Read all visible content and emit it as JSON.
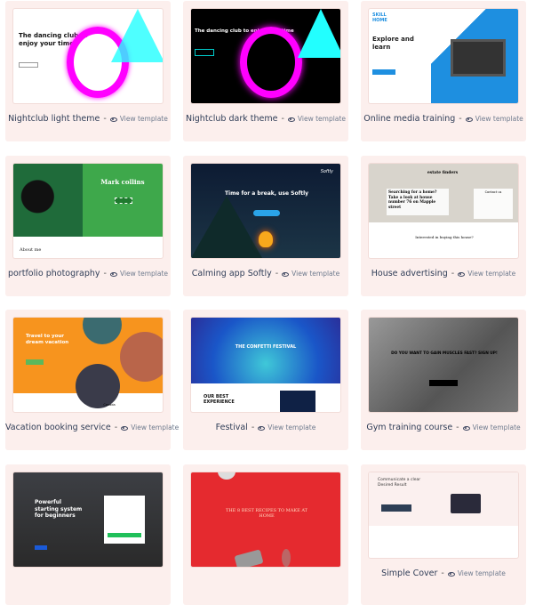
{
  "view_label": "View template",
  "templates": [
    {
      "title": "Nightclub light theme",
      "headline": "The dancing club to enjoy your time"
    },
    {
      "title": "Nightclub dark theme",
      "headline": "The dancing club to enjoy your time"
    },
    {
      "title": "Online media training",
      "headline": "Explore and learn",
      "logo": "SKILL HOME"
    },
    {
      "title": "portfolio photography",
      "headline": "Mark collins",
      "section": "About me"
    },
    {
      "title": "Calming app Softly",
      "headline": "Time for a break, use Softly",
      "logo": "Softly"
    },
    {
      "title": "House advertising",
      "headline": "Searching for a home? Take a look at house number 76 on Mapple street",
      "logo": "estate finders",
      "section": "Interested in buying this house?",
      "form": "Contact us"
    },
    {
      "title": "Vacation booking service",
      "headline": "Travel to your dream vacation",
      "section": "Canada"
    },
    {
      "title": "Festival",
      "headline": "THE CONFETTI FESTIVAL",
      "section": "OUR BEST EXPERIENCE"
    },
    {
      "title": "Gym training course",
      "headline": "DO YOU WANT TO GAIN MUSCLES FAST? SIGN UP!"
    },
    {
      "title": "",
      "headline": "Powerful starting system for beginners"
    },
    {
      "title": "",
      "headline": "THE 8 BEST RECIPES TO MAKE AT HOME"
    },
    {
      "title": "Simple Cover",
      "headline": "Communicate a clear Desired Result"
    }
  ],
  "colors": {
    "card_bg": "#fcefed",
    "title": "#2f3d57",
    "link": "#6f7b8e"
  }
}
